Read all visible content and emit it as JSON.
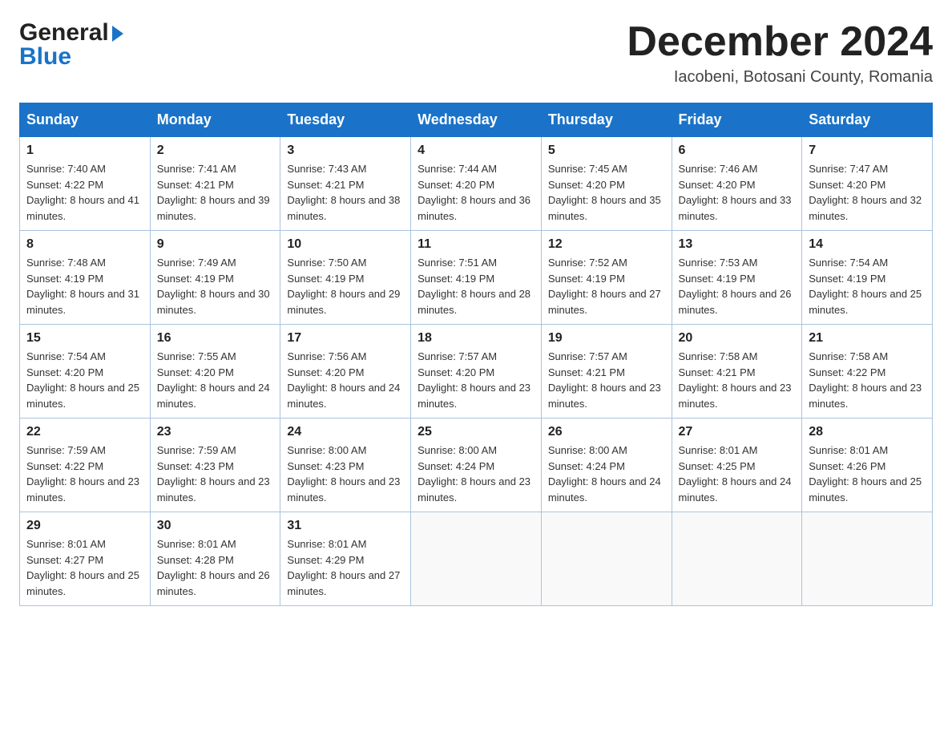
{
  "header": {
    "logo_general": "General",
    "logo_blue": "Blue",
    "month_title": "December 2024",
    "location": "Iacobeni, Botosani County, Romania"
  },
  "calendar": {
    "days_of_week": [
      "Sunday",
      "Monday",
      "Tuesday",
      "Wednesday",
      "Thursday",
      "Friday",
      "Saturday"
    ],
    "weeks": [
      [
        {
          "day": "1",
          "sunrise": "Sunrise: 7:40 AM",
          "sunset": "Sunset: 4:22 PM",
          "daylight": "Daylight: 8 hours and 41 minutes."
        },
        {
          "day": "2",
          "sunrise": "Sunrise: 7:41 AM",
          "sunset": "Sunset: 4:21 PM",
          "daylight": "Daylight: 8 hours and 39 minutes."
        },
        {
          "day": "3",
          "sunrise": "Sunrise: 7:43 AM",
          "sunset": "Sunset: 4:21 PM",
          "daylight": "Daylight: 8 hours and 38 minutes."
        },
        {
          "day": "4",
          "sunrise": "Sunrise: 7:44 AM",
          "sunset": "Sunset: 4:20 PM",
          "daylight": "Daylight: 8 hours and 36 minutes."
        },
        {
          "day": "5",
          "sunrise": "Sunrise: 7:45 AM",
          "sunset": "Sunset: 4:20 PM",
          "daylight": "Daylight: 8 hours and 35 minutes."
        },
        {
          "day": "6",
          "sunrise": "Sunrise: 7:46 AM",
          "sunset": "Sunset: 4:20 PM",
          "daylight": "Daylight: 8 hours and 33 minutes."
        },
        {
          "day": "7",
          "sunrise": "Sunrise: 7:47 AM",
          "sunset": "Sunset: 4:20 PM",
          "daylight": "Daylight: 8 hours and 32 minutes."
        }
      ],
      [
        {
          "day": "8",
          "sunrise": "Sunrise: 7:48 AM",
          "sunset": "Sunset: 4:19 PM",
          "daylight": "Daylight: 8 hours and 31 minutes."
        },
        {
          "day": "9",
          "sunrise": "Sunrise: 7:49 AM",
          "sunset": "Sunset: 4:19 PM",
          "daylight": "Daylight: 8 hours and 30 minutes."
        },
        {
          "day": "10",
          "sunrise": "Sunrise: 7:50 AM",
          "sunset": "Sunset: 4:19 PM",
          "daylight": "Daylight: 8 hours and 29 minutes."
        },
        {
          "day": "11",
          "sunrise": "Sunrise: 7:51 AM",
          "sunset": "Sunset: 4:19 PM",
          "daylight": "Daylight: 8 hours and 28 minutes."
        },
        {
          "day": "12",
          "sunrise": "Sunrise: 7:52 AM",
          "sunset": "Sunset: 4:19 PM",
          "daylight": "Daylight: 8 hours and 27 minutes."
        },
        {
          "day": "13",
          "sunrise": "Sunrise: 7:53 AM",
          "sunset": "Sunset: 4:19 PM",
          "daylight": "Daylight: 8 hours and 26 minutes."
        },
        {
          "day": "14",
          "sunrise": "Sunrise: 7:54 AM",
          "sunset": "Sunset: 4:19 PM",
          "daylight": "Daylight: 8 hours and 25 minutes."
        }
      ],
      [
        {
          "day": "15",
          "sunrise": "Sunrise: 7:54 AM",
          "sunset": "Sunset: 4:20 PM",
          "daylight": "Daylight: 8 hours and 25 minutes."
        },
        {
          "day": "16",
          "sunrise": "Sunrise: 7:55 AM",
          "sunset": "Sunset: 4:20 PM",
          "daylight": "Daylight: 8 hours and 24 minutes."
        },
        {
          "day": "17",
          "sunrise": "Sunrise: 7:56 AM",
          "sunset": "Sunset: 4:20 PM",
          "daylight": "Daylight: 8 hours and 24 minutes."
        },
        {
          "day": "18",
          "sunrise": "Sunrise: 7:57 AM",
          "sunset": "Sunset: 4:20 PM",
          "daylight": "Daylight: 8 hours and 23 minutes."
        },
        {
          "day": "19",
          "sunrise": "Sunrise: 7:57 AM",
          "sunset": "Sunset: 4:21 PM",
          "daylight": "Daylight: 8 hours and 23 minutes."
        },
        {
          "day": "20",
          "sunrise": "Sunrise: 7:58 AM",
          "sunset": "Sunset: 4:21 PM",
          "daylight": "Daylight: 8 hours and 23 minutes."
        },
        {
          "day": "21",
          "sunrise": "Sunrise: 7:58 AM",
          "sunset": "Sunset: 4:22 PM",
          "daylight": "Daylight: 8 hours and 23 minutes."
        }
      ],
      [
        {
          "day": "22",
          "sunrise": "Sunrise: 7:59 AM",
          "sunset": "Sunset: 4:22 PM",
          "daylight": "Daylight: 8 hours and 23 minutes."
        },
        {
          "day": "23",
          "sunrise": "Sunrise: 7:59 AM",
          "sunset": "Sunset: 4:23 PM",
          "daylight": "Daylight: 8 hours and 23 minutes."
        },
        {
          "day": "24",
          "sunrise": "Sunrise: 8:00 AM",
          "sunset": "Sunset: 4:23 PM",
          "daylight": "Daylight: 8 hours and 23 minutes."
        },
        {
          "day": "25",
          "sunrise": "Sunrise: 8:00 AM",
          "sunset": "Sunset: 4:24 PM",
          "daylight": "Daylight: 8 hours and 23 minutes."
        },
        {
          "day": "26",
          "sunrise": "Sunrise: 8:00 AM",
          "sunset": "Sunset: 4:24 PM",
          "daylight": "Daylight: 8 hours and 24 minutes."
        },
        {
          "day": "27",
          "sunrise": "Sunrise: 8:01 AM",
          "sunset": "Sunset: 4:25 PM",
          "daylight": "Daylight: 8 hours and 24 minutes."
        },
        {
          "day": "28",
          "sunrise": "Sunrise: 8:01 AM",
          "sunset": "Sunset: 4:26 PM",
          "daylight": "Daylight: 8 hours and 25 minutes."
        }
      ],
      [
        {
          "day": "29",
          "sunrise": "Sunrise: 8:01 AM",
          "sunset": "Sunset: 4:27 PM",
          "daylight": "Daylight: 8 hours and 25 minutes."
        },
        {
          "day": "30",
          "sunrise": "Sunrise: 8:01 AM",
          "sunset": "Sunset: 4:28 PM",
          "daylight": "Daylight: 8 hours and 26 minutes."
        },
        {
          "day": "31",
          "sunrise": "Sunrise: 8:01 AM",
          "sunset": "Sunset: 4:29 PM",
          "daylight": "Daylight: 8 hours and 27 minutes."
        },
        null,
        null,
        null,
        null
      ]
    ]
  }
}
